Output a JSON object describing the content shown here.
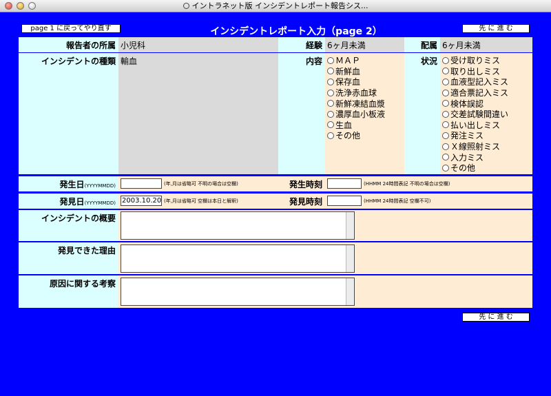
{
  "window": {
    "title": "イントラネット版 インシデントレポート報告シス..."
  },
  "header": {
    "back_label": "page 1 に戻ってやり直す",
    "title": "インシデントレポート入力（page 2）",
    "next_label": "先 に 進 む"
  },
  "reporter": {
    "dept_label": "報告者の所属",
    "dept_value": "小児科",
    "exp_label": "経験",
    "exp_value": "6ヶ月未満",
    "assign_label": "配属",
    "assign_value": "6ヶ月未満"
  },
  "incident": {
    "type_label": "インシデントの種類",
    "type_value": "輸血",
    "content_label": "内容",
    "content_options": [
      "ＭＡＰ",
      "新鮮血",
      "保存血",
      "洗浄赤血球",
      "新鮮凍結血漿",
      "濃厚血小板液",
      "生血",
      "その他"
    ],
    "status_label": "状況",
    "status_options": [
      "受け取りミス",
      "取り出しミス",
      "血液型記入ミス",
      "適合票記入ミス",
      "検体誤認",
      "交差試験間違い",
      "払い出しミス",
      "発注ミス",
      "Ｘ線照射ミス",
      "入力ミス",
      "その他"
    ]
  },
  "occur": {
    "date_label": "発生日",
    "date_format": "(YYYYMMDD)",
    "date_value": "",
    "date_note": "(年,月は省略可 不明の場合は空欄)",
    "time_label": "発生時刻",
    "time_value": "",
    "time_note": "(HHMM 24時間表記 不明の場合は空欄)"
  },
  "found": {
    "date_label": "発見日",
    "date_format": "(YYYYMMDD)",
    "date_value": "2003.10.20",
    "date_note": "(年,月は省略可 空欄は本日と解釈)",
    "time_label": "発見時刻",
    "time_value": "",
    "time_note": "(HHMM 24時間表記 空欄不可)"
  },
  "texts": {
    "summary_label": "インシデントの概要",
    "reason_label": "発見できた理由",
    "cause_label": "原因に関する考察"
  },
  "footer": {
    "next_label": "先 に 進 む"
  }
}
